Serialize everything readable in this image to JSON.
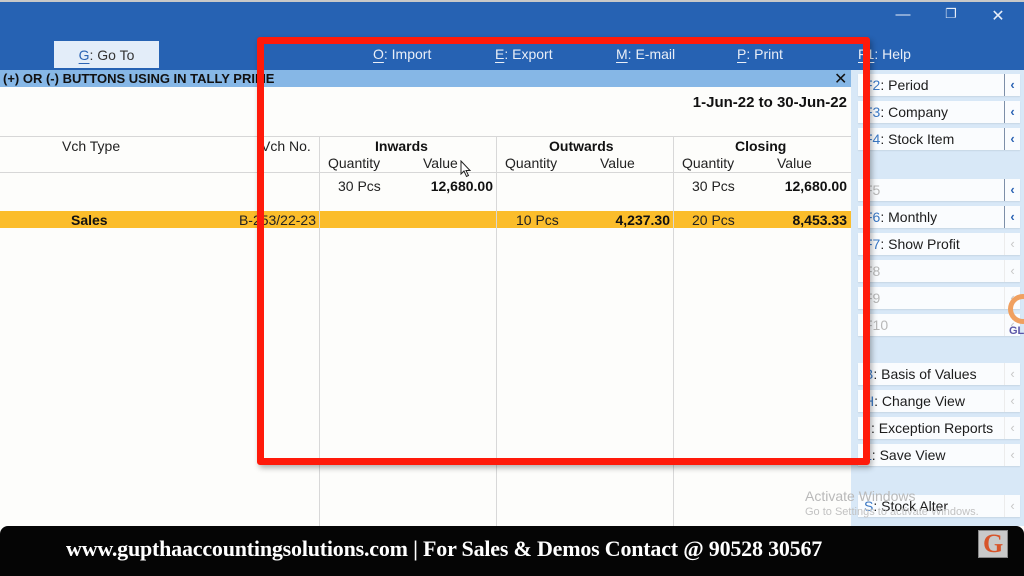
{
  "window_controls": {
    "minimize": "—",
    "restore": "❐",
    "close": "✕"
  },
  "toolbar": {
    "goto": {
      "key": "G",
      "label": ": Go To"
    },
    "items": [
      {
        "key": "O",
        "label": ": Import"
      },
      {
        "key": "E",
        "label": ": Export"
      },
      {
        "key": "M",
        "label": ": E-mail"
      },
      {
        "key": "P",
        "label": ": Print"
      },
      {
        "key": "F1",
        "label": ": Help"
      }
    ]
  },
  "report": {
    "title": "(+) OR (-) BUTTONS USING IN TALLY PRIME",
    "close": "✕",
    "period": "1-Jun-22 to 30-Jun-22"
  },
  "table": {
    "columns": {
      "vch_type": "Vch Type",
      "vch_no": "Vch No.",
      "inwards": "Inwards",
      "outwards": "Outwards",
      "closing": "Closing",
      "quantity": "Quantity",
      "value": "Value"
    },
    "opening_row": {
      "in_qty": "30 Pcs",
      "in_val": "12,680.00",
      "out_qty": "",
      "out_val": "",
      "cl_qty": "30 Pcs",
      "cl_val": "12,680.00"
    },
    "rows": [
      {
        "vch_type": "Sales",
        "vch_no": "B-253/22-23",
        "in_qty": "",
        "in_val": "",
        "out_qty": "10 Pcs",
        "out_val": "4,237.30",
        "cl_qty": "20 Pcs",
        "cl_val": "8,453.33",
        "selected": true
      }
    ]
  },
  "side_panel": {
    "buttons": [
      {
        "key": "F2",
        "label": ": Period",
        "enabled": true
      },
      {
        "key": "F3",
        "label": ": Company",
        "enabled": true
      },
      {
        "key": "F4",
        "label": ": Stock Item",
        "enabled": true
      },
      {
        "key": "F5",
        "label": "",
        "enabled": false
      },
      {
        "key": "F6",
        "label": ": Monthly",
        "enabled": true
      },
      {
        "key": "F7",
        "label": ": Show Profit",
        "enabled": true
      },
      {
        "key": "F8",
        "label": "",
        "enabled": false
      },
      {
        "key": "F9",
        "label": "",
        "enabled": false
      },
      {
        "key": "F10",
        "label": "",
        "enabled": false
      },
      {
        "key": "B",
        "label": ": Basis of Values",
        "enabled": true
      },
      {
        "key": "H",
        "label": ": Change View",
        "enabled": true
      },
      {
        "key": "J",
        "label": ": Exception Reports",
        "enabled": true
      },
      {
        "key": "L",
        "label": ": Save View",
        "enabled": true
      },
      {
        "key": "S",
        "label": ": Stock Alter",
        "enabled": true
      }
    ],
    "logo_text": "GL"
  },
  "watermark": {
    "title": "Activate Windows",
    "subtitle": "Go to Settings to activate Windows."
  },
  "footer": {
    "text": "www.gupthaaccountingsolutions.com | For Sales & Demos Contact @ 90528 30567",
    "logo_letter": "G"
  },
  "colors": {
    "topbar": "#2662b3",
    "report_bar": "#86b7e6",
    "selected_row": "#fbbd2b",
    "side_panel": "#d8e8f7",
    "highlight": "#ff1a0a",
    "footer": "#050505"
  }
}
